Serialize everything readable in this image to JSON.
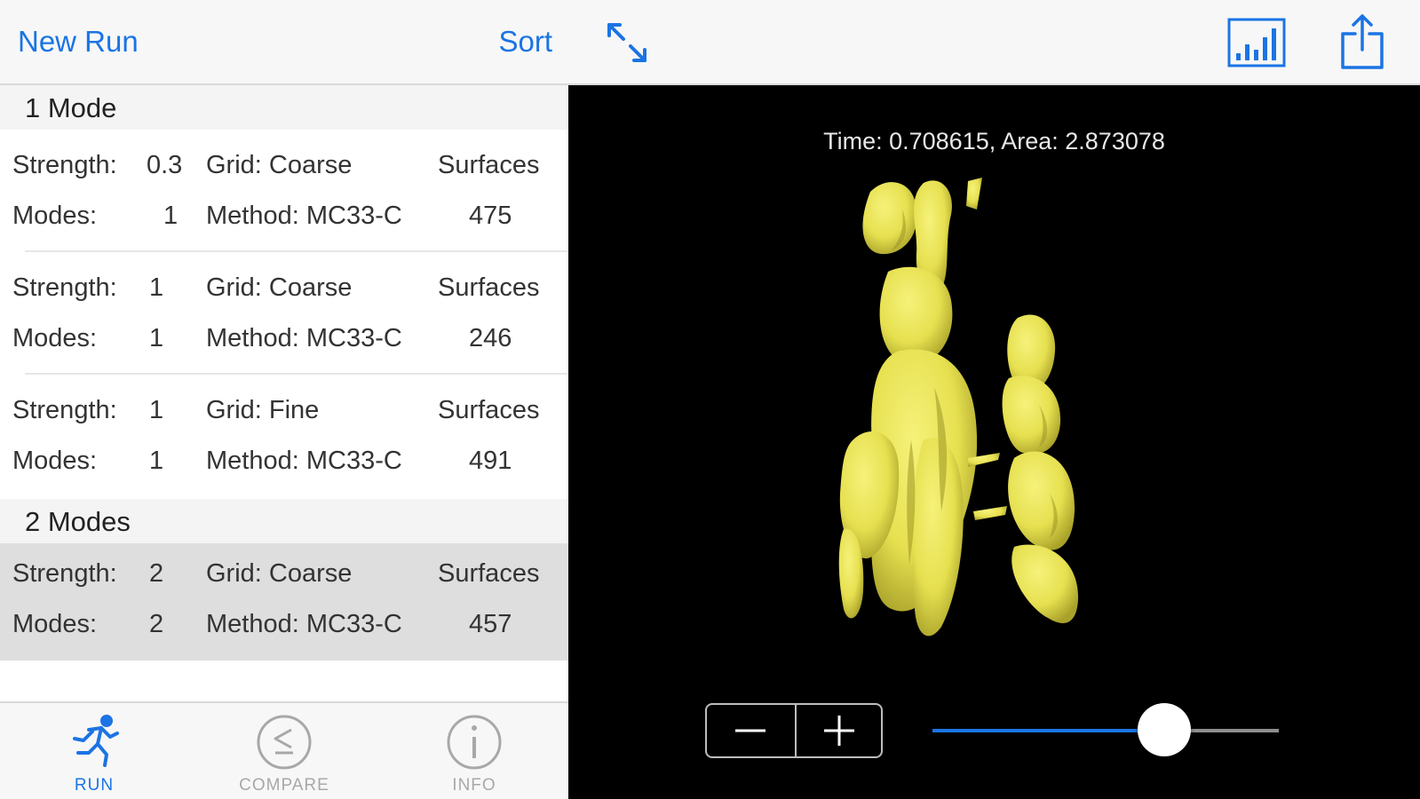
{
  "nav": {
    "new_run": "New Run",
    "sort": "Sort"
  },
  "sections": [
    {
      "title": "1 Mode",
      "runs": [
        {
          "strength_label": "Strength:",
          "strength": "0.3",
          "grid": "Grid: Coarse",
          "surfaces_label": "Surfaces",
          "modes_label": "Modes:",
          "modes": "1",
          "method": "Method: MC33-C",
          "surfaces": "475"
        },
        {
          "strength_label": "Strength:",
          "strength": "1",
          "grid": "Grid: Coarse",
          "surfaces_label": "Surfaces",
          "modes_label": "Modes:",
          "modes": "1",
          "method": "Method: MC33-C",
          "surfaces": "246"
        },
        {
          "strength_label": "Strength:",
          "strength": "1",
          "grid": "Grid: Fine",
          "surfaces_label": "Surfaces",
          "modes_label": "Modes:",
          "modes": "1",
          "method": "Method: MC33-C",
          "surfaces": "491"
        }
      ]
    },
    {
      "title": "2 Modes",
      "runs": [
        {
          "strength_label": "Strength:",
          "strength": "2",
          "grid": "Grid: Coarse",
          "surfaces_label": "Surfaces",
          "modes_label": "Modes:",
          "modes": "2",
          "method": "Method: MC33-C",
          "surfaces": "457",
          "selected": true
        }
      ]
    }
  ],
  "tabs": [
    {
      "label": "RUN",
      "icon": "runner-icon",
      "active": true
    },
    {
      "label": "COMPARE",
      "icon": "less-equal-icon",
      "active": false
    },
    {
      "label": "INFO",
      "icon": "info-icon",
      "active": false
    }
  ],
  "viewer": {
    "status": "Time: 0.708615,  Area: 2.873078",
    "surface_color": "#e8e35a",
    "slider_level": 0.67
  },
  "toolbar": {
    "icons": [
      "expand-icon",
      "bar-chart-icon",
      "share-icon"
    ]
  },
  "colors": {
    "accent": "#1b74e4",
    "inactive": "#a8a8a8",
    "selection": "#dedede"
  }
}
